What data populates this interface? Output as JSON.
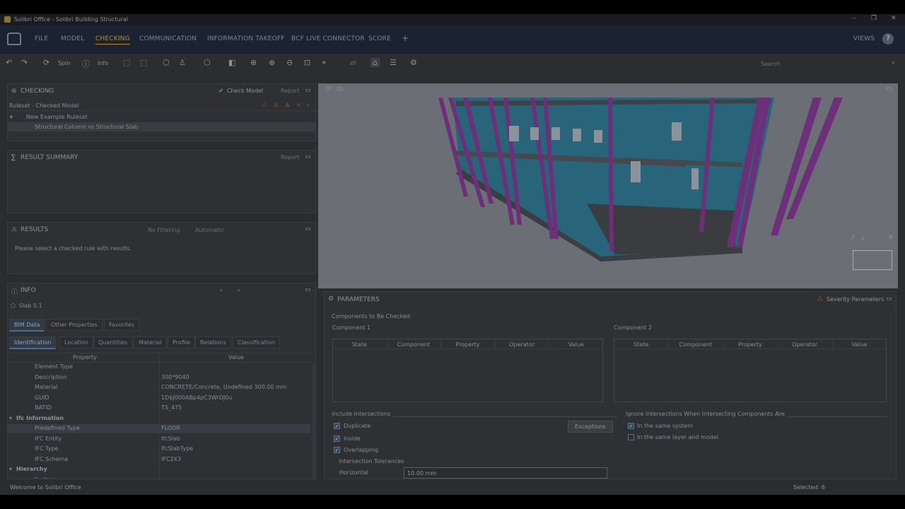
{
  "window": {
    "title": "Solibri Office - Solibri Building Structural"
  },
  "menu": {
    "items": [
      "FILE",
      "MODEL",
      "CHECKING",
      "COMMUNICATION",
      "INFORMATION TAKEOFF",
      "BCF LIVE CONNECTOR",
      "SCORE"
    ],
    "active": "CHECKING",
    "views": "VIEWS",
    "help": "?",
    "plus": "+"
  },
  "toolbar": {
    "spin": "Spin",
    "info": "Info",
    "search_placeholder": "Search"
  },
  "checking": {
    "title": "CHECKING",
    "check_model": "Check Model",
    "report": "Report",
    "ruleset": "Ruleset - Checked Model",
    "rows": [
      "New Example Ruleset",
      "Structural Column vs Structural Slab"
    ]
  },
  "result_summary": {
    "title": "RESULT SUMMARY",
    "report": "Report"
  },
  "results": {
    "title": "RESULTS",
    "filter": "No Filtering",
    "auto": "Automatic",
    "message": "Please select a checked rule with results."
  },
  "info": {
    "title": "INFO",
    "selected": "Slab 0.1",
    "tabs": [
      "BIM Data",
      "Other Properties",
      "Favorites"
    ],
    "subtabs": [
      "Identification",
      "Location",
      "Quantities",
      "Material",
      "Profile",
      "Relations",
      "Classification"
    ],
    "col_property": "Property",
    "col_value": "Value",
    "rows": [
      {
        "p": "Element Type",
        "v": "",
        "indent": 1
      },
      {
        "p": "Description",
        "v": "300*9040",
        "indent": 1
      },
      {
        "p": "Material",
        "v": "CONCRETE/Concrete, Undefined 300.00 mm",
        "indent": 1
      },
      {
        "p": "GUID",
        "v": "1D$J000ABp4pC3WrDJ0u",
        "indent": 1
      },
      {
        "p": "BATID",
        "v": "TS_475",
        "indent": 1
      },
      {
        "p": "Ifc Information",
        "v": "",
        "indent": 0
      },
      {
        "p": "Predefined Type",
        "v": "FLOOR",
        "indent": 1
      },
      {
        "p": "IFC Entity",
        "v": "IfcSlab",
        "indent": 1
      },
      {
        "p": "IFC Type",
        "v": "IfcSlabType",
        "indent": 1
      },
      {
        "p": "IFC Schema",
        "v": "IFC2X3",
        "indent": 1
      },
      {
        "p": "Hierarchy",
        "v": "",
        "indent": 0
      },
      {
        "p": "System",
        "v": "",
        "indent": 1
      }
    ]
  },
  "view3d": {
    "label": "3D",
    "axis_num": "3"
  },
  "params": {
    "title": "PARAMETERS",
    "severity": "Severity Parameters",
    "components_title": "Components to Be Checked",
    "comp1": "Component 1",
    "comp2": "Component 2",
    "cols": [
      "State",
      "Component",
      "Property",
      "Operator",
      "Value"
    ],
    "include_title": "Include Intersections",
    "duplicate": "Duplicate",
    "inside": "Inside",
    "overlapping": "Overlapping",
    "exceptions": "Exceptions",
    "tolerances": "Intersection Tolerances",
    "horizontal": "Horizontal",
    "horizontal_value": "10.00 mm",
    "ignore_title": "Ignore Intersections When Intersecting Components Are",
    "same_system": "In the same system",
    "same_layer": "In the same layer and model"
  },
  "status": {
    "welcome": "Welcome to Solibri Office",
    "selected": "Selected: 6"
  }
}
